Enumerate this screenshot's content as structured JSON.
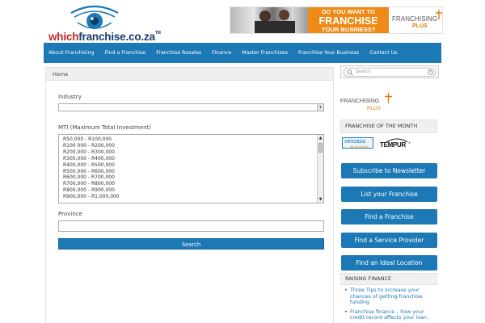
{
  "header": {
    "logo_prefix": "which",
    "logo_domain": "franchise.co.za",
    "logo_tm": "TM"
  },
  "ad": {
    "line1": "DO YOU WANT TO",
    "line2": "FRANCHISE",
    "line3": "YOUR BUSINESS?",
    "brand": "FRANCHISING",
    "brand_sub": "PLUS",
    "accent_color": "#ef8a16"
  },
  "nav": {
    "items": [
      "About Franchising",
      "Find a Franchise",
      "Franchise Resales",
      "Finance",
      "Master Franchises",
      "Franchise Your Business",
      "Contact Us"
    ],
    "color": "#1d79b6"
  },
  "breadcrumb": "Home",
  "form": {
    "industry_label": "Industry",
    "industry_value": "",
    "mti_label": "MTI (Maximum Total Investment)",
    "mti_options": [
      "R50,000 - R100,000",
      "R100 000 - R200,000",
      "R200,000 - R300,000",
      "R300,000 - R400,000",
      "R400,000 - R500,000",
      "R500,000 - R600,000",
      "R600,000 - R700,000",
      "R700,000 - R800,000",
      "R800,000 - R900,000",
      "R900,000 - R1,000,000"
    ],
    "province_label": "Province",
    "province_value": "",
    "search_label": "Search"
  },
  "sidebar": {
    "search_placeholder": "Search",
    "fplus_brand": "FRANCHISING",
    "fplus_sub": "PLUS",
    "fotm_title": "FRANCHISE OF THE MONTH",
    "vencasa_name": "vencasa",
    "vencasa_tag": "the art of living",
    "tempur_name": "TEMPUR",
    "tempur_reg": "®",
    "buttons": [
      "Subscribe to Newsletter",
      "List your Franchise",
      "Find a Franchise",
      "Find a Service Provider",
      "Find an Ideal Location"
    ],
    "raising_finance_title": "RAISING FINANCE",
    "raising_finance_items": [
      "Three Tips to increase your chances of getting franchise funding",
      "Franchise finance – how your credit record affects your loan"
    ]
  }
}
